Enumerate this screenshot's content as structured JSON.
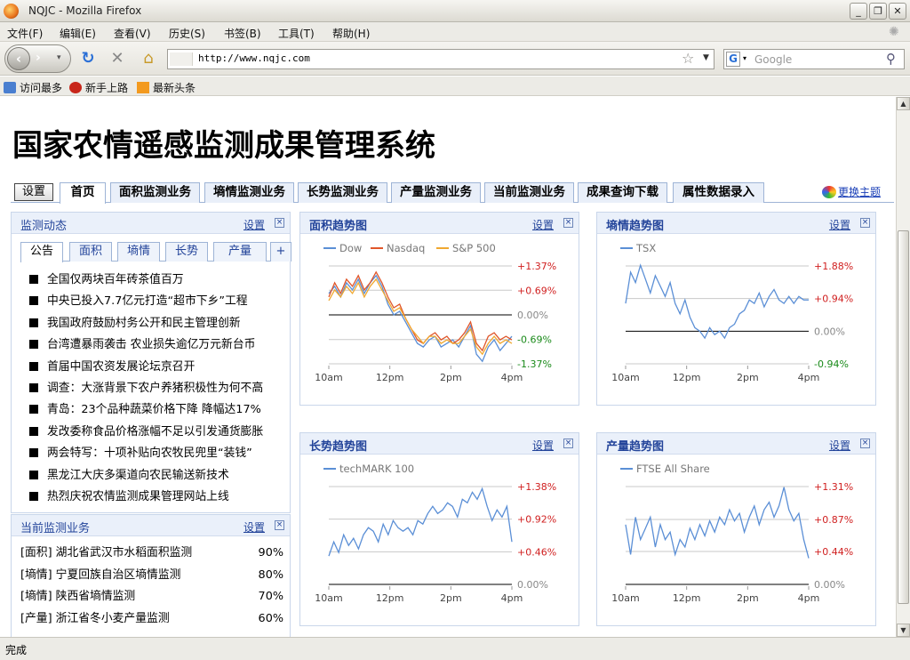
{
  "browser": {
    "window_title": "NQJC - Mozilla Firefox",
    "menu": [
      "文件(F)",
      "编辑(E)",
      "查看(V)",
      "历史(S)",
      "书签(B)",
      "工具(T)",
      "帮助(H)"
    ],
    "url": "http://www.nqjc.com",
    "search_placeholder": "Google",
    "bookmarks": [
      "访问最多",
      "新手上路",
      "最新头条"
    ],
    "status": "完成"
  },
  "site": {
    "title": "国家农情遥感监测成果管理系统",
    "settings_button": "设置",
    "nav_tabs": [
      "首页",
      "面积监测业务",
      "墒情监测业务",
      "长势监测业务",
      "产量监测业务",
      "当前监测业务",
      "成果查询下载",
      "属性数据录入"
    ],
    "active_tab": "首页",
    "change_theme": "更换主题"
  },
  "widgets": {
    "settings_link": "设置",
    "close_glyph": "×",
    "monitoring_news": {
      "title": "监测动态",
      "tabs": [
        "公告",
        "面积",
        "墒情",
        "长势",
        "产量",
        "+"
      ],
      "active_tab": "公告",
      "items": [
        "首届中国农资发展论坛京召开",
        "调查：大涨背景下农户养猪积极性为何不高",
        "青岛：23个品种蔬菜价格下降 降幅达17%",
        "发改委称食品价格涨幅不足以引发通货膨胀",
        "两会特写：十项补贴向农牧民兜里“装钱”",
        "黑龙江大庆多渠道向农民输送新技术",
        "热烈庆祝农情监测成果管理网站上线"
      ],
      "items_top": [
        "全国仅两块百年砖茶值百万",
        "中央已投入7.7亿元打造“超市下乡”工程",
        "我国政府鼓励村务公开和民主管理创新",
        "台湾遭暴雨袭击 农业损失逾亿万元新台币"
      ]
    },
    "current_business": {
      "title": "当前监测业务",
      "rows": [
        {
          "text": "[面积] 湖北省武汉市水稻面积监测",
          "pct": "90%"
        },
        {
          "text": "[墒情] 宁夏回族自治区墒情监测",
          "pct": "80%"
        },
        {
          "text": "[墒情] 陕西省墒情监测",
          "pct": "70%"
        },
        {
          "text": "[产量] 浙江省冬小麦产量监测",
          "pct": "60%"
        }
      ]
    },
    "area_trend": {
      "title": "面积趋势图"
    },
    "moisture_trend": {
      "title": "墒情趋势图"
    },
    "growth_trend": {
      "title": "长势趋势图"
    },
    "yield_trend": {
      "title": "产量趋势图"
    }
  },
  "chart_data": [
    {
      "id": "area",
      "type": "line",
      "x_ticks": [
        "10am",
        "12pm",
        "2pm",
        "4pm"
      ],
      "y_ticks": [
        "+1.37%",
        "+0.69%",
        "0.00%",
        "-0.69%",
        "-1.37%"
      ],
      "y_tick_values": [
        1.37,
        0.69,
        0.0,
        -0.69,
        -1.37
      ],
      "ylim": [
        -1.37,
        1.37
      ],
      "legend": "top",
      "series": [
        {
          "name": "Dow",
          "color": "#5b8fd6",
          "values": [
            0.6,
            0.8,
            0.5,
            0.9,
            0.7,
            1.0,
            0.6,
            0.9,
            1.1,
            0.8,
            0.3,
            0.0,
            0.1,
            -0.2,
            -0.5,
            -0.8,
            -0.9,
            -0.7,
            -0.6,
            -0.9,
            -0.8,
            -0.7,
            -0.9,
            -0.6,
            -0.3,
            -1.1,
            -1.3,
            -0.9,
            -0.7,
            -1.0,
            -0.8,
            -0.6
          ]
        },
        {
          "name": "Nasdaq",
          "color": "#e0562a",
          "values": [
            0.5,
            0.9,
            0.6,
            1.0,
            0.8,
            1.1,
            0.7,
            0.9,
            1.2,
            0.9,
            0.5,
            0.2,
            0.3,
            -0.1,
            -0.4,
            -0.7,
            -0.8,
            -0.6,
            -0.5,
            -0.7,
            -0.6,
            -0.8,
            -0.7,
            -0.5,
            -0.2,
            -0.8,
            -1.0,
            -0.6,
            -0.5,
            -0.7,
            -0.6,
            -0.7
          ]
        },
        {
          "name": "S&P 500",
          "color": "#f0a830",
          "values": [
            0.4,
            0.7,
            0.5,
            0.8,
            0.6,
            0.9,
            0.5,
            0.8,
            1.0,
            0.7,
            0.4,
            0.1,
            0.2,
            -0.1,
            -0.4,
            -0.6,
            -0.8,
            -0.6,
            -0.6,
            -0.8,
            -0.7,
            -0.8,
            -0.8,
            -0.6,
            -0.4,
            -0.9,
            -1.1,
            -0.8,
            -0.6,
            -0.8,
            -0.7,
            -0.8
          ]
        }
      ]
    },
    {
      "id": "moisture",
      "type": "line",
      "x_ticks": [
        "10am",
        "12pm",
        "2pm",
        "4pm"
      ],
      "y_ticks": [
        "+1.88%",
        "+0.94%",
        "0.00%",
        "-0.94%"
      ],
      "y_tick_values": [
        1.88,
        0.94,
        0.0,
        -0.94
      ],
      "ylim": [
        -0.94,
        1.88
      ],
      "legend": "top",
      "series": [
        {
          "name": "TSX",
          "color": "#5b8fd6",
          "values": [
            0.8,
            1.7,
            1.4,
            1.9,
            1.5,
            1.1,
            1.6,
            1.3,
            1.0,
            1.4,
            0.8,
            0.5,
            0.9,
            0.4,
            0.1,
            0.0,
            -0.2,
            0.1,
            -0.1,
            0.0,
            -0.2,
            0.1,
            0.2,
            0.5,
            0.6,
            0.9,
            0.8,
            1.1,
            0.7,
            1.0,
            1.2,
            0.9,
            0.8,
            1.0,
            0.8,
            1.0,
            0.9,
            0.9
          ]
        }
      ]
    },
    {
      "id": "growth",
      "type": "line",
      "x_ticks": [
        "10am",
        "12pm",
        "2pm",
        "4pm"
      ],
      "y_ticks": [
        "+1.38%",
        "+0.92%",
        "+0.46%",
        "0.00%"
      ],
      "y_tick_values": [
        1.38,
        0.92,
        0.46,
        0.0
      ],
      "ylim": [
        0.0,
        1.38
      ],
      "legend": "top",
      "series": [
        {
          "name": "techMARK 100",
          "color": "#5b8fd6",
          "values": [
            0.4,
            0.6,
            0.45,
            0.7,
            0.55,
            0.65,
            0.5,
            0.7,
            0.8,
            0.75,
            0.6,
            0.85,
            0.7,
            0.9,
            0.8,
            0.75,
            0.8,
            0.7,
            0.9,
            0.85,
            1.0,
            1.1,
            1.0,
            1.05,
            1.15,
            1.1,
            0.95,
            1.2,
            1.15,
            1.3,
            1.2,
            1.35,
            1.1,
            0.9,
            1.05,
            0.95,
            1.1,
            0.6
          ]
        }
      ]
    },
    {
      "id": "yield",
      "type": "line",
      "x_ticks": [
        "10am",
        "12pm",
        "2pm",
        "4pm"
      ],
      "y_ticks": [
        "+1.31%",
        "+0.87%",
        "+0.44%",
        "0.00%"
      ],
      "y_tick_values": [
        1.31,
        0.87,
        0.44,
        0.0
      ],
      "ylim": [
        0.0,
        1.31
      ],
      "legend": "top",
      "series": [
        {
          "name": "FTSE All Share",
          "color": "#5b8fd6",
          "values": [
            0.8,
            0.4,
            0.9,
            0.6,
            0.75,
            0.9,
            0.5,
            0.8,
            0.6,
            0.7,
            0.4,
            0.6,
            0.5,
            0.75,
            0.6,
            0.8,
            0.65,
            0.85,
            0.7,
            0.9,
            0.8,
            1.0,
            0.85,
            0.95,
            0.7,
            0.9,
            1.05,
            0.8,
            1.0,
            1.1,
            0.9,
            1.05,
            1.3,
            1.0,
            0.85,
            0.95,
            0.6,
            0.35
          ]
        }
      ]
    }
  ]
}
